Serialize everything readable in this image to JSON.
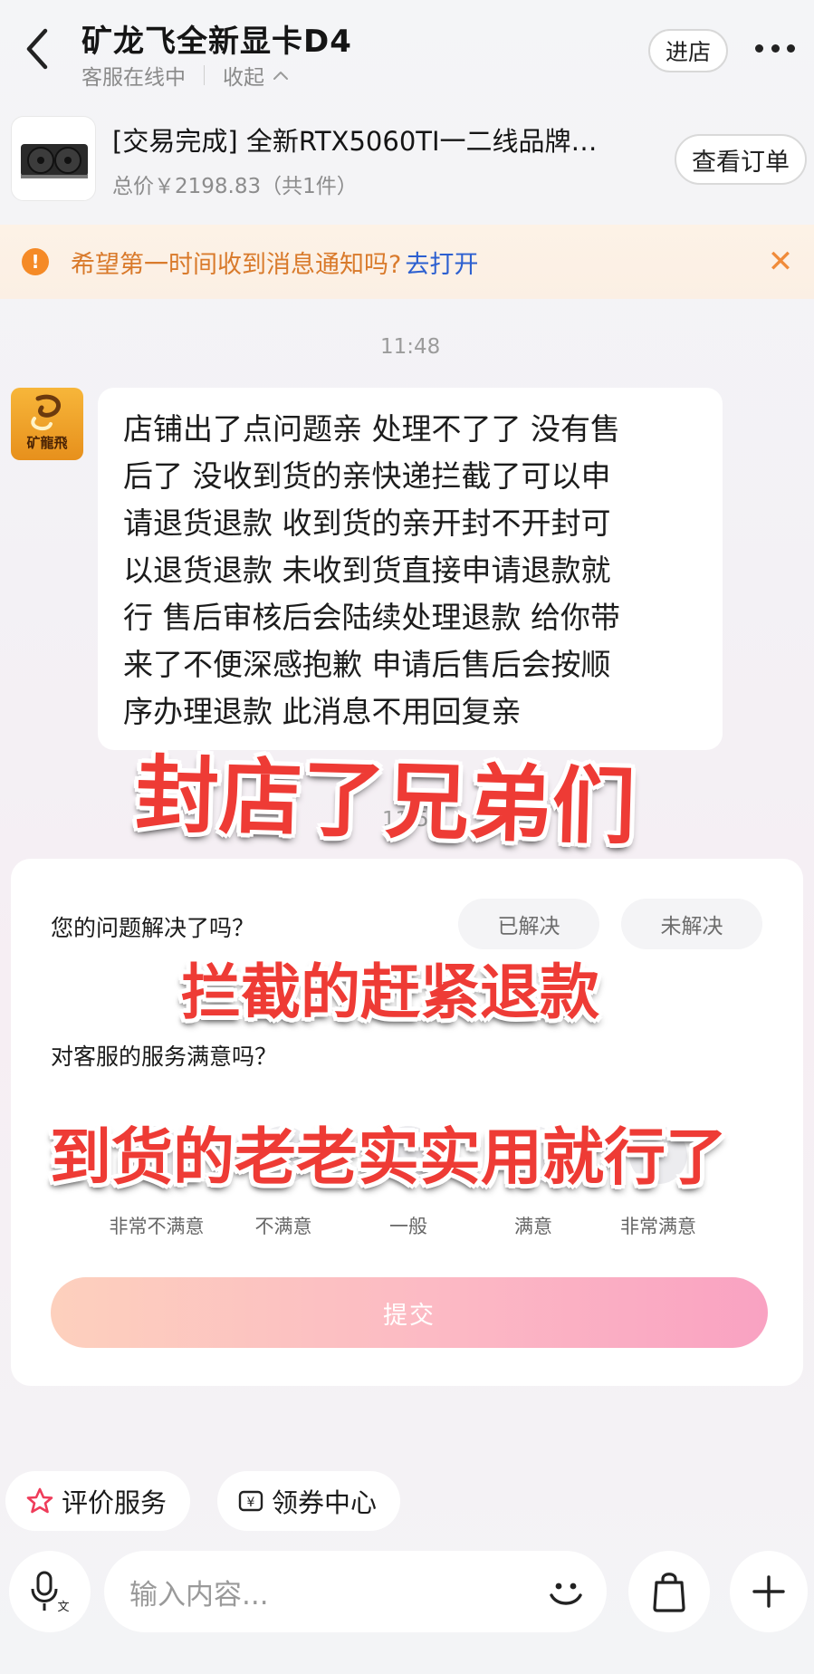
{
  "header": {
    "title": "矿龙飞全新显卡D4",
    "status": "客服在线中",
    "collapse_label": "收起",
    "store_button": "进店"
  },
  "order": {
    "title": "[交易完成] 全新RTX5060TI一二线品牌…",
    "price": "总价￥2198.83（共1件）",
    "view_order_button": "查看订单"
  },
  "notice": {
    "text": "希望第一时间收到消息通知吗?",
    "link": "去打开"
  },
  "chat": {
    "time1": "11:48",
    "time2": "11:57",
    "avatar_text": "矿龍飛",
    "message_lines": [
      "店铺出了点问题亲 处理不了了 没有售",
      "后了  没收到货的亲快递拦截了可以申",
      "请退货退款 收到货的亲开封不开封可",
      "以退货退款 未收到货直接申请退款就",
      "行  售后审核后会陆续处理退款 给你带",
      "来了不便深感抱歉  申请后售后会按顺",
      "序办理退款 此消息不用回复亲"
    ]
  },
  "feedback": {
    "question1": "您的问题解决了吗？",
    "resolved": "已解决",
    "unresolved": "未解决",
    "question2": "对客服的服务满意吗？",
    "ratings": [
      "非常不满意",
      "不满意",
      "一般",
      "满意",
      "非常满意"
    ],
    "submit": "提交"
  },
  "overlays": {
    "line1": "封店了兄弟们",
    "line2": "拦截的赶紧退款",
    "line3": "到货的老老实实用就行了"
  },
  "chips": {
    "review": "评价服务",
    "coupon": "领券中心"
  },
  "input": {
    "placeholder": "输入内容..."
  },
  "colors": {
    "overlay_red": "#ee3b35",
    "notice_orange": "#f58a26",
    "link_blue": "#2c5fd0",
    "submit_pink": "#f9a2c2"
  }
}
